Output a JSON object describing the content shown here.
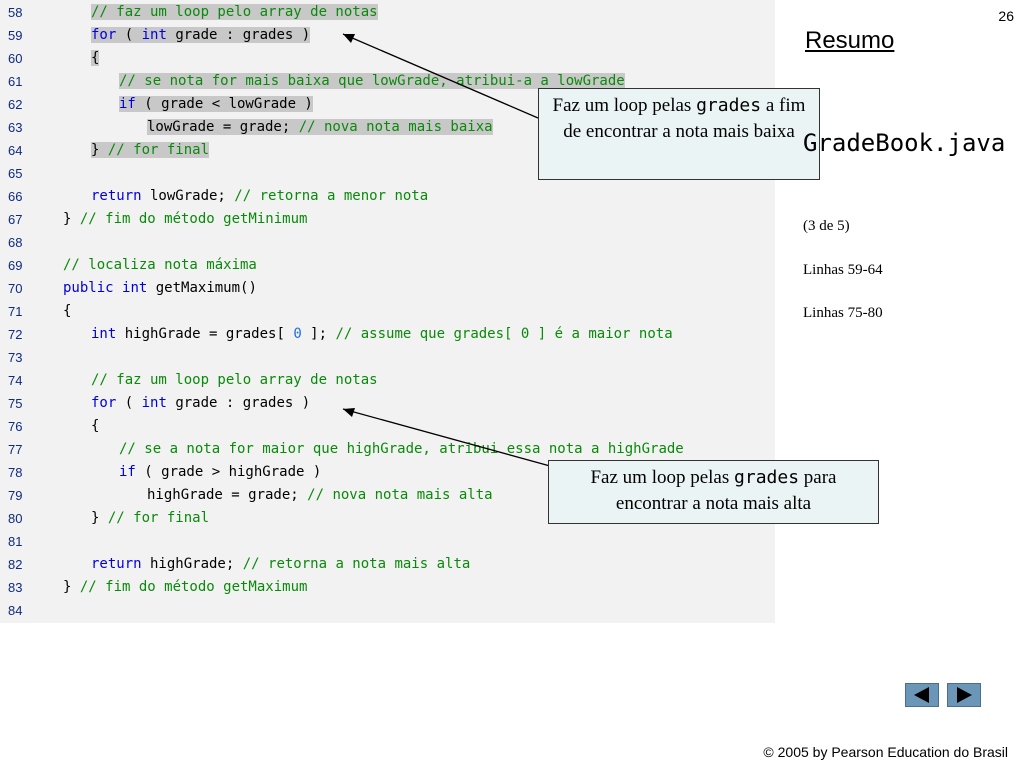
{
  "slide": {
    "number": "26",
    "title": "Resumo",
    "filename": "GradeBook.java",
    "part": "(3 de 5)",
    "lines_ref_1": "Linhas 59-64",
    "lines_ref_2": "Linhas 75-80",
    "footer": "© 2005 by Pearson Education do Brasil"
  },
  "callouts": {
    "min": {
      "text_before": "Faz um loop pelas ",
      "mono": "grades",
      "text_after": " a fim de encontrar a nota mais baixa"
    },
    "max": {
      "text_before": "Faz um loop pelas ",
      "mono": "grades",
      "text_after": " para encontrar a nota mais alta"
    }
  },
  "nav": {
    "prev_icon": "triangle-left-icon",
    "next_icon": "triangle-right-icon"
  },
  "colors": {
    "keyword": "#0000e0",
    "comment": "#0a8a0a",
    "number": "#1e6ee6",
    "line_number": "#0f2a82",
    "highlight": "#c8c8c8",
    "nav": "#6b96b8"
  },
  "code_lines": [
    {
      "num": "58",
      "indent": 2,
      "hl": true,
      "tokens": [
        {
          "t": "cm",
          "v": "// faz um loop pelo array de notas"
        }
      ]
    },
    {
      "num": "59",
      "indent": 2,
      "hl": true,
      "tokens": [
        {
          "t": "kw",
          "v": "for"
        },
        {
          "t": "tx",
          "v": " ( "
        },
        {
          "t": "kw",
          "v": "int"
        },
        {
          "t": "tx",
          "v": " grade : grades )"
        }
      ]
    },
    {
      "num": "60",
      "indent": 2,
      "hl": true,
      "tokens": [
        {
          "t": "tx",
          "v": "{"
        }
      ]
    },
    {
      "num": "61",
      "indent": 3,
      "hl": true,
      "tokens": [
        {
          "t": "cm",
          "v": "// se nota for mais baixa que lowGrade, atribui-a a lowGrade"
        }
      ]
    },
    {
      "num": "62",
      "indent": 3,
      "hl": true,
      "tokens": [
        {
          "t": "kw",
          "v": "if"
        },
        {
          "t": "tx",
          "v": " ( grade < lowGrade )"
        }
      ]
    },
    {
      "num": "63",
      "indent": 4,
      "hl": true,
      "tokens": [
        {
          "t": "tx",
          "v": "lowGrade = grade; "
        },
        {
          "t": "cm",
          "v": "// nova nota mais baixa"
        }
      ]
    },
    {
      "num": "64",
      "indent": 2,
      "hl": true,
      "tokens": [
        {
          "t": "tx",
          "v": "} "
        },
        {
          "t": "cm",
          "v": "// for final"
        }
      ]
    },
    {
      "num": "65",
      "indent": 0,
      "hl": false,
      "tokens": []
    },
    {
      "num": "66",
      "indent": 2,
      "hl": false,
      "tokens": [
        {
          "t": "kw",
          "v": "return"
        },
        {
          "t": "tx",
          "v": " lowGrade; "
        },
        {
          "t": "cm",
          "v": "// retorna a menor nota"
        }
      ]
    },
    {
      "num": "67",
      "indent": 1,
      "hl": false,
      "tokens": [
        {
          "t": "tx",
          "v": "} "
        },
        {
          "t": "cm",
          "v": "// fim do método getMinimum"
        }
      ]
    },
    {
      "num": "68",
      "indent": 0,
      "hl": false,
      "tokens": []
    },
    {
      "num": "69",
      "indent": 1,
      "hl": false,
      "tokens": [
        {
          "t": "cm",
          "v": "// localiza nota máxima"
        }
      ]
    },
    {
      "num": "70",
      "indent": 1,
      "hl": false,
      "tokens": [
        {
          "t": "kw",
          "v": "public"
        },
        {
          "t": "tx",
          "v": " "
        },
        {
          "t": "kw",
          "v": "int"
        },
        {
          "t": "tx",
          "v": " getMaximum()"
        }
      ]
    },
    {
      "num": "71",
      "indent": 1,
      "hl": false,
      "tokens": [
        {
          "t": "tx",
          "v": "{"
        }
      ]
    },
    {
      "num": "72",
      "indent": 2,
      "hl": false,
      "tokens": [
        {
          "t": "kw",
          "v": "int"
        },
        {
          "t": "tx",
          "v": " highGrade = grades[ "
        },
        {
          "t": "num",
          "v": "0"
        },
        {
          "t": "tx",
          "v": " ]; "
        },
        {
          "t": "cm",
          "v": "// assume que grades[ 0 ] é a maior nota"
        }
      ]
    },
    {
      "num": "73",
      "indent": 0,
      "hl": false,
      "tokens": []
    },
    {
      "num": "74",
      "indent": 2,
      "hl": false,
      "tokens": [
        {
          "t": "cm",
          "v": "// faz um loop pelo array de notas"
        }
      ]
    },
    {
      "num": "75",
      "indent": 2,
      "hl": false,
      "tokens": [
        {
          "t": "kw",
          "v": "for"
        },
        {
          "t": "tx",
          "v": " ( "
        },
        {
          "t": "kw",
          "v": "int"
        },
        {
          "t": "tx",
          "v": " grade : grades )"
        }
      ]
    },
    {
      "num": "76",
      "indent": 2,
      "hl": false,
      "tokens": [
        {
          "t": "tx",
          "v": "{"
        }
      ]
    },
    {
      "num": "77",
      "indent": 3,
      "hl": false,
      "tokens": [
        {
          "t": "cm",
          "v": "// se a nota for maior que highGrade, atribui essa nota a highGrade"
        }
      ]
    },
    {
      "num": "78",
      "indent": 3,
      "hl": false,
      "tokens": [
        {
          "t": "kw",
          "v": "if"
        },
        {
          "t": "tx",
          "v": " ( grade > highGrade )"
        }
      ]
    },
    {
      "num": "79",
      "indent": 4,
      "hl": false,
      "tokens": [
        {
          "t": "tx",
          "v": "highGrade = grade; "
        },
        {
          "t": "cm",
          "v": "// nova nota mais alta"
        }
      ]
    },
    {
      "num": "80",
      "indent": 2,
      "hl": false,
      "tokens": [
        {
          "t": "tx",
          "v": "} "
        },
        {
          "t": "cm",
          "v": "// for final"
        }
      ]
    },
    {
      "num": "81",
      "indent": 0,
      "hl": false,
      "tokens": []
    },
    {
      "num": "82",
      "indent": 2,
      "hl": false,
      "tokens": [
        {
          "t": "kw",
          "v": "return"
        },
        {
          "t": "tx",
          "v": " highGrade; "
        },
        {
          "t": "cm",
          "v": "// retorna a nota mais alta"
        }
      ]
    },
    {
      "num": "83",
      "indent": 1,
      "hl": false,
      "tokens": [
        {
          "t": "tx",
          "v": "} "
        },
        {
          "t": "cm",
          "v": "// fim do método getMaximum"
        }
      ]
    },
    {
      "num": "84",
      "indent": 0,
      "hl": false,
      "tokens": []
    }
  ]
}
